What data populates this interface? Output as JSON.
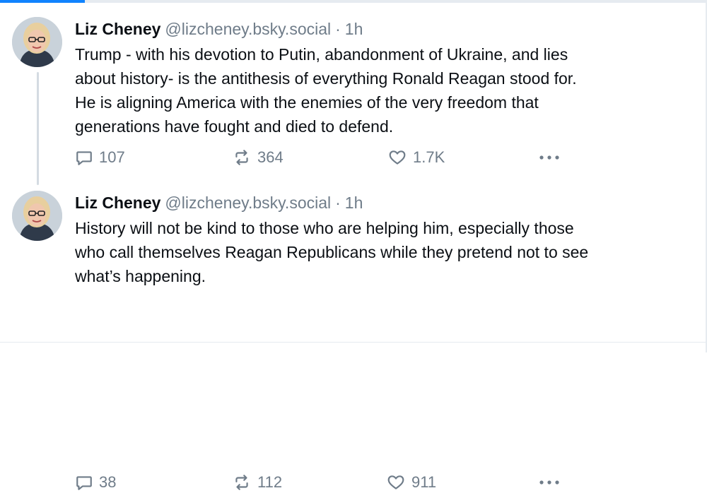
{
  "posts": [
    {
      "author_name": "Liz Cheney",
      "handle": "@lizcheney.bsky.social",
      "separator": "·",
      "time": "1h",
      "lines": [
        "Trump - with his devotion to Putin, abandonment of Ukraine, and lies",
        "about history- is the antithesis of everything Ronald Reagan stood for.",
        "He is aligning America with the enemies of the very freedom that",
        "generations have fought and died to defend."
      ],
      "replies": "107",
      "reposts": "364",
      "likes": "1.7K"
    },
    {
      "author_name": "Liz Cheney",
      "handle": "@lizcheney.bsky.social",
      "separator": "·",
      "time": "1h",
      "lines": [
        "History will not be kind to those who are helping him, especially those",
        "who call themselves Reagan Republicans while they pretend not to see",
        "what’s happening."
      ],
      "replies": "38",
      "reposts": "112",
      "likes": "911"
    }
  ],
  "icons": {
    "reply": "reply-icon",
    "repost": "repost-icon",
    "like": "heart-icon",
    "more": "more-options-icon"
  },
  "colors": {
    "text": "#0b0f14",
    "muted": "#6f7c89",
    "accent": "#1083fe"
  }
}
